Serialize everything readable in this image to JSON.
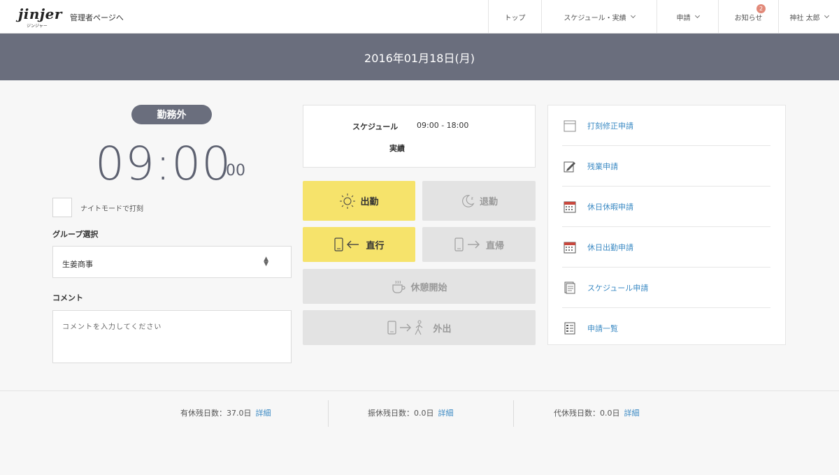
{
  "header": {
    "logo_text": "jinjer",
    "logo_sub": "ジンジャー",
    "admin_link": "管理者ページへ",
    "nav": [
      {
        "label": "トップ",
        "dropdown": false
      },
      {
        "label": "スケジュール・実績",
        "dropdown": true
      },
      {
        "label": "申請",
        "dropdown": true
      },
      {
        "label": "お知らせ",
        "dropdown": false,
        "badge": "2"
      },
      {
        "label": "神社 太郎",
        "dropdown": true
      }
    ]
  },
  "date_bar": "2016年01月18日(月)",
  "clock": {
    "status": "勤務外",
    "time": "09:00",
    "seconds": "00"
  },
  "night_mode_label": "ナイトモードで打刻",
  "group": {
    "label": "グループ選択",
    "value": "生姜商事"
  },
  "comment": {
    "label": "コメント",
    "placeholder": "コメントを入力してください"
  },
  "schedule": {
    "label": "スケジュール",
    "time": "09:00 - 18:00",
    "actual_label": "実績"
  },
  "actions": {
    "clock_in": "出勤",
    "clock_out": "退勤",
    "direct_go": "直行",
    "direct_return": "直帰",
    "break_start": "休憩開始",
    "go_out": "外出"
  },
  "requests": [
    {
      "label": "打刻修正申請",
      "icon": "calendar-blank-icon"
    },
    {
      "label": "残業申請",
      "icon": "pencil-edit-icon"
    },
    {
      "label": "休日休暇申請",
      "icon": "calendar-icon"
    },
    {
      "label": "休日出勤申請",
      "icon": "calendar-icon"
    },
    {
      "label": "スケジュール申請",
      "icon": "document-icon"
    },
    {
      "label": "申請一覧",
      "icon": "list-icon"
    }
  ],
  "footer": {
    "paid_leave": {
      "label": "有休残日数：",
      "value": "37.0日",
      "link": "詳細"
    },
    "substitute_leave": {
      "label": "振休残日数：",
      "value": "0.0日",
      "link": "詳細"
    },
    "compensatory_leave": {
      "label": "代休残日数：",
      "value": "0.0日",
      "link": "詳細"
    }
  },
  "colors": {
    "header_bar": "#6a6e7d",
    "accent_yellow": "#f6e36b",
    "link_blue": "#3d8bc4",
    "badge": "#e28a7a"
  }
}
